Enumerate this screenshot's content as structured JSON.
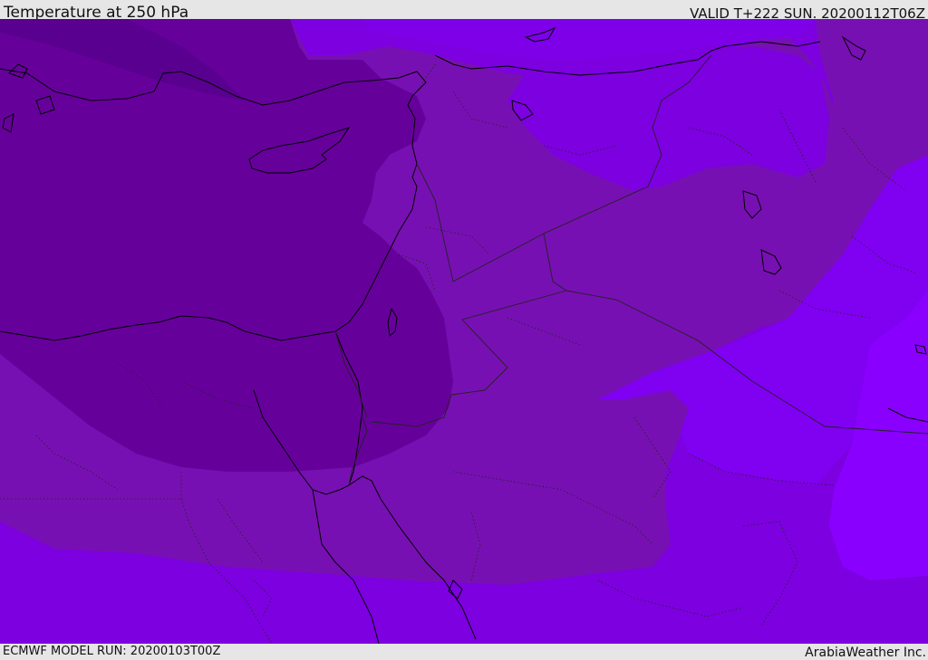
{
  "header": {
    "title": "Temperature at 250 hPa",
    "valid_time": "VALID T+222 SUN. 20200112T06Z"
  },
  "footer": {
    "model_run": "ECMWF MODEL RUN: 20200103T00Z",
    "credit": "ArabiaWeather Inc."
  },
  "map": {
    "colors": {
      "coldest": "#5a0090",
      "cold": "#66009b",
      "mid": "#7710b2",
      "warm": "#7d00e0",
      "warmer": "#8000f2",
      "warmest": "#8a00ff",
      "coastline": "#000000",
      "borders": "#222222"
    }
  }
}
